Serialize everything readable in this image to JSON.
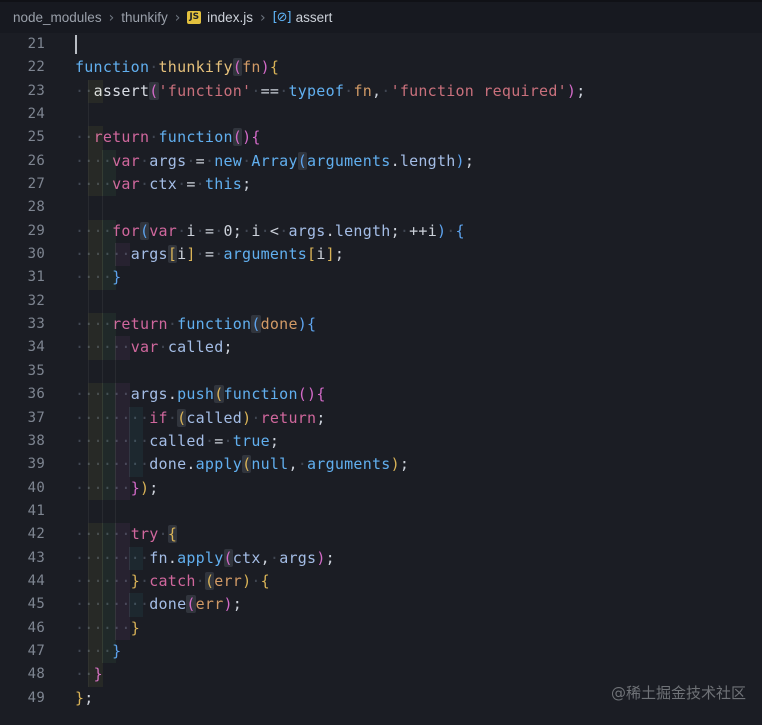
{
  "breadcrumb": {
    "items": [
      {
        "label": "node_modules",
        "icon": null,
        "bright": false
      },
      {
        "label": "thunkify",
        "icon": null,
        "bright": false
      },
      {
        "label": "index.js",
        "icon": "js-file-icon",
        "icon_text": "JS",
        "bright": true
      },
      {
        "label": "assert",
        "icon": "symbol-variable-icon",
        "icon_text": "[⊘]",
        "bright": true
      }
    ],
    "separator": "›"
  },
  "watermark": "@稀土掘金技术社区",
  "colors": {
    "editor_bg": "#1b1d24",
    "breadcrumb_bg": "#171920",
    "accent_gold_bracket": "#d9b357",
    "accent_orchid_bracket": "#d36ac8",
    "accent_blue_bracket": "#5da3ee",
    "keyword_pink": "#d0679d",
    "keyword_blue": "#61afef",
    "function_yellow": "#e5c07b",
    "param_orange": "#d19a66",
    "variable_periwinkle": "#a4bde6",
    "string_rose": "#c9707c",
    "js_badge_bg": "#e3c13e",
    "indent_tints": [
      "rgba(255,255,64,0.055)",
      "rgba(127,255,127,0.055)",
      "rgba(255,127,255,0.055)",
      "rgba(79,236,236,0.055)"
    ]
  },
  "editor": {
    "lines": [
      {
        "num": "21",
        "tints": 0,
        "guides": 0,
        "cursor": true,
        "tokens": []
      },
      {
        "num": "22",
        "tints": 0,
        "guides": 0,
        "tokens": [
          {
            "t": "function",
            "c": "bl"
          },
          {
            "t": "·",
            "c": "ws"
          },
          {
            "t": "thunkify",
            "c": "fy"
          },
          {
            "t": "(",
            "c": "bO",
            "h": 1
          },
          {
            "t": "fn",
            "c": "pa"
          },
          {
            "t": ")",
            "c": "bO"
          },
          {
            "t": "{",
            "c": "bG"
          }
        ]
      },
      {
        "num": "23",
        "tints": 1,
        "guides": 0,
        "tokens": [
          {
            "t": "··",
            "c": "ws"
          },
          {
            "t": "assert",
            "c": "id"
          },
          {
            "t": "(",
            "c": "bO",
            "h": 1
          },
          {
            "t": "'function'",
            "c": "st"
          },
          {
            "t": "·",
            "c": "ws"
          },
          {
            "t": "==",
            "c": "df"
          },
          {
            "t": "·",
            "c": "ws"
          },
          {
            "t": "typeof",
            "c": "bl"
          },
          {
            "t": "·",
            "c": "ws"
          },
          {
            "t": "fn",
            "c": "pa"
          },
          {
            "t": ",",
            "c": "df"
          },
          {
            "t": "·",
            "c": "ws"
          },
          {
            "t": "'function required'",
            "c": "st"
          },
          {
            "t": ")",
            "c": "bO"
          },
          {
            "t": ";",
            "c": "df"
          }
        ]
      },
      {
        "num": "24",
        "tints": 0,
        "guides": 1,
        "tokens": []
      },
      {
        "num": "25",
        "tints": 1,
        "guides": 0,
        "tokens": [
          {
            "t": "··",
            "c": "ws"
          },
          {
            "t": "return",
            "c": "kw"
          },
          {
            "t": "·",
            "c": "ws"
          },
          {
            "t": "function",
            "c": "bl"
          },
          {
            "t": "(",
            "c": "bO",
            "h": 1
          },
          {
            "t": ")",
            "c": "bO"
          },
          {
            "t": "{",
            "c": "bO"
          }
        ]
      },
      {
        "num": "26",
        "tints": 2,
        "guides": 0,
        "tokens": [
          {
            "t": "····",
            "c": "ws"
          },
          {
            "t": "var",
            "c": "kw"
          },
          {
            "t": "·",
            "c": "ws"
          },
          {
            "t": "args",
            "c": "va"
          },
          {
            "t": "·",
            "c": "ws"
          },
          {
            "t": "=",
            "c": "df"
          },
          {
            "t": "·",
            "c": "ws"
          },
          {
            "t": "new",
            "c": "bl"
          },
          {
            "t": "·",
            "c": "ws"
          },
          {
            "t": "Array",
            "c": "bl"
          },
          {
            "t": "(",
            "c": "bB",
            "h": 1
          },
          {
            "t": "arguments",
            "c": "bl"
          },
          {
            "t": ".",
            "c": "df"
          },
          {
            "t": "length",
            "c": "va"
          },
          {
            "t": ")",
            "c": "bB"
          },
          {
            "t": ";",
            "c": "df"
          }
        ]
      },
      {
        "num": "27",
        "tints": 2,
        "guides": 0,
        "tokens": [
          {
            "t": "····",
            "c": "ws"
          },
          {
            "t": "var",
            "c": "kw"
          },
          {
            "t": "·",
            "c": "ws"
          },
          {
            "t": "ctx",
            "c": "va"
          },
          {
            "t": "·",
            "c": "ws"
          },
          {
            "t": "=",
            "c": "df"
          },
          {
            "t": "·",
            "c": "ws"
          },
          {
            "t": "this",
            "c": "bl"
          },
          {
            "t": ";",
            "c": "df"
          }
        ]
      },
      {
        "num": "28",
        "tints": 0,
        "guides": 2,
        "tokens": []
      },
      {
        "num": "29",
        "tints": 2,
        "guides": 0,
        "tokens": [
          {
            "t": "····",
            "c": "ws"
          },
          {
            "t": "for",
            "c": "kw"
          },
          {
            "t": "(",
            "c": "bB",
            "h": 1
          },
          {
            "t": "var",
            "c": "kw"
          },
          {
            "t": "·",
            "c": "ws"
          },
          {
            "t": "i",
            "c": "df"
          },
          {
            "t": "·",
            "c": "ws"
          },
          {
            "t": "=",
            "c": "df"
          },
          {
            "t": "·",
            "c": "ws"
          },
          {
            "t": "0",
            "c": "df"
          },
          {
            "t": ";",
            "c": "df"
          },
          {
            "t": "·",
            "c": "ws"
          },
          {
            "t": "i",
            "c": "df"
          },
          {
            "t": "·",
            "c": "ws"
          },
          {
            "t": "<",
            "c": "df"
          },
          {
            "t": "·",
            "c": "ws"
          },
          {
            "t": "args",
            "c": "va"
          },
          {
            "t": ".",
            "c": "df"
          },
          {
            "t": "length",
            "c": "va"
          },
          {
            "t": ";",
            "c": "df"
          },
          {
            "t": "·",
            "c": "ws"
          },
          {
            "t": "++",
            "c": "df"
          },
          {
            "t": "i",
            "c": "df"
          },
          {
            "t": ")",
            "c": "bB"
          },
          {
            "t": "·",
            "c": "ws"
          },
          {
            "t": "{",
            "c": "bB"
          }
        ]
      },
      {
        "num": "30",
        "tints": 3,
        "guides": 0,
        "tokens": [
          {
            "t": "······",
            "c": "ws"
          },
          {
            "t": "args",
            "c": "va"
          },
          {
            "t": "[",
            "c": "bG",
            "h": 1
          },
          {
            "t": "i",
            "c": "df"
          },
          {
            "t": "]",
            "c": "bG"
          },
          {
            "t": "·",
            "c": "ws"
          },
          {
            "t": "=",
            "c": "df"
          },
          {
            "t": "·",
            "c": "ws"
          },
          {
            "t": "arguments",
            "c": "bl"
          },
          {
            "t": "[",
            "c": "bG"
          },
          {
            "t": "i",
            "c": "df"
          },
          {
            "t": "]",
            "c": "bG"
          },
          {
            "t": ";",
            "c": "df"
          }
        ]
      },
      {
        "num": "31",
        "tints": 2,
        "guides": 0,
        "tokens": [
          {
            "t": "····",
            "c": "ws"
          },
          {
            "t": "}",
            "c": "bB"
          }
        ]
      },
      {
        "num": "32",
        "tints": 0,
        "guides": 2,
        "tokens": []
      },
      {
        "num": "33",
        "tints": 2,
        "guides": 0,
        "tokens": [
          {
            "t": "····",
            "c": "ws"
          },
          {
            "t": "return",
            "c": "kw"
          },
          {
            "t": "·",
            "c": "ws"
          },
          {
            "t": "function",
            "c": "bl"
          },
          {
            "t": "(",
            "c": "bB",
            "h": 1
          },
          {
            "t": "done",
            "c": "pa"
          },
          {
            "t": ")",
            "c": "bB"
          },
          {
            "t": "{",
            "c": "bB"
          }
        ]
      },
      {
        "num": "34",
        "tints": 3,
        "guides": 0,
        "tokens": [
          {
            "t": "······",
            "c": "ws"
          },
          {
            "t": "var",
            "c": "kw"
          },
          {
            "t": "·",
            "c": "ws"
          },
          {
            "t": "called",
            "c": "va"
          },
          {
            "t": ";",
            "c": "df"
          }
        ]
      },
      {
        "num": "35",
        "tints": 0,
        "guides": 3,
        "tokens": []
      },
      {
        "num": "36",
        "tints": 3,
        "guides": 0,
        "tokens": [
          {
            "t": "······",
            "c": "ws"
          },
          {
            "t": "args",
            "c": "va"
          },
          {
            "t": ".",
            "c": "df"
          },
          {
            "t": "push",
            "c": "bl"
          },
          {
            "t": "(",
            "c": "bG",
            "h": 1
          },
          {
            "t": "function",
            "c": "bl"
          },
          {
            "t": "(",
            "c": "bO"
          },
          {
            "t": ")",
            "c": "bO"
          },
          {
            "t": "{",
            "c": "bO"
          }
        ]
      },
      {
        "num": "37",
        "tints": 4,
        "guides": 0,
        "tokens": [
          {
            "t": "········",
            "c": "ws"
          },
          {
            "t": "if",
            "c": "kw"
          },
          {
            "t": "·",
            "c": "ws"
          },
          {
            "t": "(",
            "c": "bG",
            "h": 1
          },
          {
            "t": "called",
            "c": "va"
          },
          {
            "t": ")",
            "c": "bG"
          },
          {
            "t": "·",
            "c": "ws"
          },
          {
            "t": "return",
            "c": "kw"
          },
          {
            "t": ";",
            "c": "df"
          }
        ]
      },
      {
        "num": "38",
        "tints": 4,
        "guides": 0,
        "tokens": [
          {
            "t": "········",
            "c": "ws"
          },
          {
            "t": "called",
            "c": "va"
          },
          {
            "t": "·",
            "c": "ws"
          },
          {
            "t": "=",
            "c": "df"
          },
          {
            "t": "·",
            "c": "ws"
          },
          {
            "t": "true",
            "c": "bl"
          },
          {
            "t": ";",
            "c": "df"
          }
        ]
      },
      {
        "num": "39",
        "tints": 4,
        "guides": 0,
        "tokens": [
          {
            "t": "········",
            "c": "ws"
          },
          {
            "t": "done",
            "c": "va"
          },
          {
            "t": ".",
            "c": "df"
          },
          {
            "t": "apply",
            "c": "bl"
          },
          {
            "t": "(",
            "c": "bG",
            "h": 1
          },
          {
            "t": "null",
            "c": "bl"
          },
          {
            "t": ",",
            "c": "df"
          },
          {
            "t": "·",
            "c": "ws"
          },
          {
            "t": "arguments",
            "c": "bl"
          },
          {
            "t": ")",
            "c": "bG"
          },
          {
            "t": ";",
            "c": "df"
          }
        ]
      },
      {
        "num": "40",
        "tints": 3,
        "guides": 0,
        "tokens": [
          {
            "t": "······",
            "c": "ws"
          },
          {
            "t": "}",
            "c": "bO"
          },
          {
            "t": ")",
            "c": "bG"
          },
          {
            "t": ";",
            "c": "df"
          }
        ]
      },
      {
        "num": "41",
        "tints": 0,
        "guides": 3,
        "tokens": []
      },
      {
        "num": "42",
        "tints": 3,
        "guides": 0,
        "tokens": [
          {
            "t": "······",
            "c": "ws"
          },
          {
            "t": "try",
            "c": "kw"
          },
          {
            "t": "·",
            "c": "ws"
          },
          {
            "t": "{",
            "c": "bG",
            "h": 1
          }
        ]
      },
      {
        "num": "43",
        "tints": 4,
        "guides": 0,
        "tokens": [
          {
            "t": "········",
            "c": "ws"
          },
          {
            "t": "fn",
            "c": "va"
          },
          {
            "t": ".",
            "c": "df"
          },
          {
            "t": "apply",
            "c": "bl"
          },
          {
            "t": "(",
            "c": "bO",
            "h": 1
          },
          {
            "t": "ctx",
            "c": "va"
          },
          {
            "t": ",",
            "c": "df"
          },
          {
            "t": "·",
            "c": "ws"
          },
          {
            "t": "args",
            "c": "va"
          },
          {
            "t": ")",
            "c": "bO"
          },
          {
            "t": ";",
            "c": "df"
          }
        ]
      },
      {
        "num": "44",
        "tints": 3,
        "guides": 0,
        "tokens": [
          {
            "t": "······",
            "c": "ws"
          },
          {
            "t": "}",
            "c": "bG"
          },
          {
            "t": "·",
            "c": "ws"
          },
          {
            "t": "catch",
            "c": "kw"
          },
          {
            "t": "·",
            "c": "ws"
          },
          {
            "t": "(",
            "c": "bG",
            "h": 1
          },
          {
            "t": "err",
            "c": "pa"
          },
          {
            "t": ")",
            "c": "bG"
          },
          {
            "t": "·",
            "c": "ws"
          },
          {
            "t": "{",
            "c": "bG"
          }
        ]
      },
      {
        "num": "45",
        "tints": 4,
        "guides": 0,
        "tokens": [
          {
            "t": "········",
            "c": "ws"
          },
          {
            "t": "done",
            "c": "va"
          },
          {
            "t": "(",
            "c": "bO",
            "h": 1
          },
          {
            "t": "err",
            "c": "pa"
          },
          {
            "t": ")",
            "c": "bO"
          },
          {
            "t": ";",
            "c": "df"
          }
        ]
      },
      {
        "num": "46",
        "tints": 3,
        "guides": 0,
        "tokens": [
          {
            "t": "······",
            "c": "ws"
          },
          {
            "t": "}",
            "c": "bG"
          }
        ]
      },
      {
        "num": "47",
        "tints": 2,
        "guides": 0,
        "tokens": [
          {
            "t": "····",
            "c": "ws"
          },
          {
            "t": "}",
            "c": "bB"
          }
        ]
      },
      {
        "num": "48",
        "tints": 1,
        "guides": 0,
        "tokens": [
          {
            "t": "··",
            "c": "ws"
          },
          {
            "t": "}",
            "c": "bO"
          }
        ]
      },
      {
        "num": "49",
        "tints": 0,
        "guides": 0,
        "tokens": [
          {
            "t": "}",
            "c": "bG"
          },
          {
            "t": ";",
            "c": "df"
          }
        ]
      }
    ]
  }
}
